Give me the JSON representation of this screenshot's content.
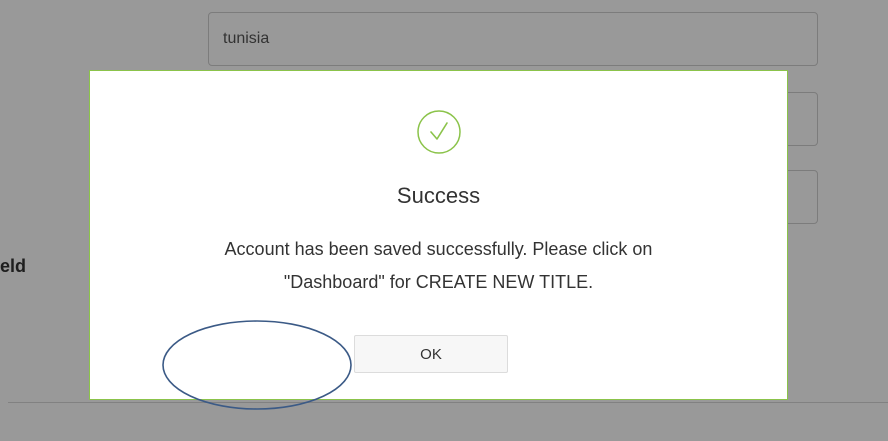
{
  "background": {
    "country_input_value": "tunisia",
    "side_label": "eld"
  },
  "modal": {
    "icon": "check-circle-icon",
    "title": "Success",
    "message_line1": "Account has been saved successfully. Please click on",
    "message_line2": "\"Dashboard\" for CREATE NEW TITLE.",
    "ok_label": "OK"
  },
  "colors": {
    "success_green": "#8bc34a",
    "annotation_blue": "#3b5a86"
  }
}
